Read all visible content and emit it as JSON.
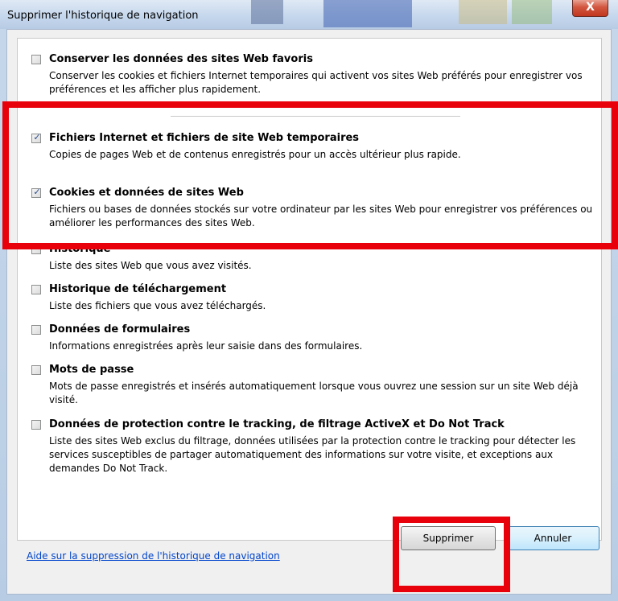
{
  "window": {
    "title": "Supprimer l'historique de navigation",
    "close_glyph": "X"
  },
  "options": [
    {
      "title": "Conserver les données des sites Web favoris",
      "description": "Conserver les cookies et fichiers Internet temporaires qui activent vos sites Web préférés pour enregistrer vos préférences et les afficher plus rapidement.",
      "checked": false
    },
    {
      "title": "Fichiers Internet et fichiers de site Web temporaires",
      "description": "Copies de pages Web et de contenus enregistrés pour un accès ultérieur plus rapide.",
      "checked": true
    },
    {
      "title": "Cookies et données de sites Web",
      "description": "Fichiers ou bases de données stockés sur votre ordinateur par les sites Web pour enregistrer vos préférences ou améliorer les performances des sites Web.",
      "checked": true
    },
    {
      "title": "Historique",
      "description": "Liste des sites Web que vous avez visités.",
      "checked": false
    },
    {
      "title": "Historique de téléchargement",
      "description": "Liste des fichiers que vous avez téléchargés.",
      "checked": false
    },
    {
      "title": "Données de formulaires",
      "description": "Informations enregistrées après leur saisie dans des formulaires.",
      "checked": false
    },
    {
      "title": "Mots de passe",
      "description": "Mots de passe enregistrés et insérés automatiquement lorsque vous ouvrez une session sur un site Web déjà visité.",
      "checked": false
    },
    {
      "title": "Données de protection contre le tracking, de filtrage ActiveX et Do Not Track",
      "description": "Liste des sites Web exclus du filtrage, données utilisées par la protection contre le tracking pour détecter les services susceptibles de partager automatiquement des informations sur votre visite, et exceptions aux demandes Do Not Track.",
      "checked": false
    }
  ],
  "footer": {
    "help_link": "Aide sur la suppression de l'historique de navigation",
    "delete_button": "Supprimer",
    "cancel_button": "Annuler"
  },
  "colors": {
    "highlight": "#e8000a",
    "link": "#0044cc"
  }
}
